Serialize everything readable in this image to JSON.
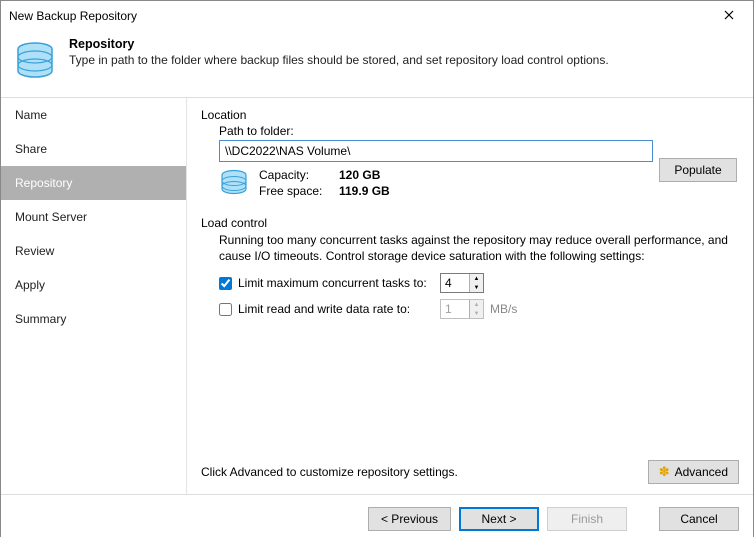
{
  "window": {
    "title": "New Backup Repository"
  },
  "header": {
    "heading": "Repository",
    "subheading": "Type in path to the folder where backup files should be stored, and set repository load control options."
  },
  "sidebar": {
    "steps": [
      "Name",
      "Share",
      "Repository",
      "Mount Server",
      "Review",
      "Apply",
      "Summary"
    ],
    "active_index": 2
  },
  "location": {
    "section_label": "Location",
    "path_label": "Path to folder:",
    "path_value": "\\\\DC2022\\NAS Volume\\",
    "capacity_label": "Capacity:",
    "capacity_value": "120 GB",
    "freespace_label": "Free space:",
    "freespace_value": "119.9 GB",
    "populate_label": "Populate"
  },
  "load": {
    "section_label": "Load control",
    "description": "Running too many concurrent tasks against the repository may reduce overall performance, and cause I/O timeouts. Control storage device saturation with the following settings:",
    "limit_tasks_label": "Limit maximum concurrent tasks to:",
    "limit_tasks_checked": true,
    "limit_tasks_value": "4",
    "limit_rate_label": "Limit read and write data rate to:",
    "limit_rate_checked": false,
    "limit_rate_value": "1",
    "limit_rate_unit": "MB/s"
  },
  "footer": {
    "hint": "Click Advanced to customize repository settings.",
    "advanced_label": "Advanced"
  },
  "buttons": {
    "previous": "< Previous",
    "next": "Next >",
    "finish": "Finish",
    "cancel": "Cancel"
  }
}
